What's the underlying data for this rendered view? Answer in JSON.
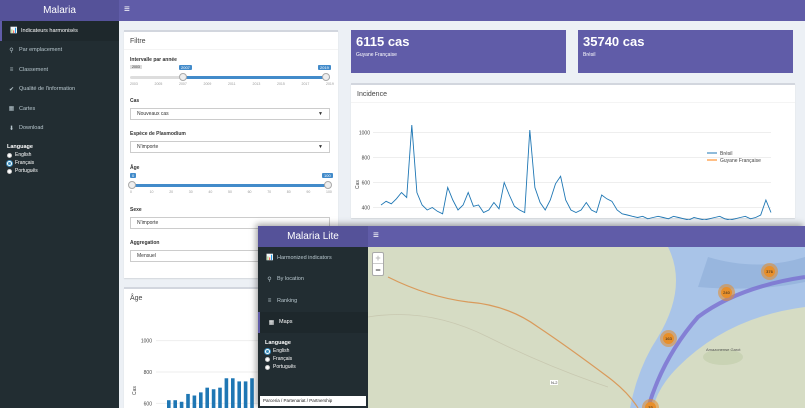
{
  "back": {
    "app_title": "Malaria",
    "hamburger": "≡",
    "nav": [
      {
        "icon": "📊",
        "label": "Indicateurs harmonisés"
      },
      {
        "icon": "⚲",
        "label": "Par emplacement"
      },
      {
        "icon": "≡",
        "label": "Classement"
      },
      {
        "icon": "✔",
        "label": "Qualité de l'information"
      },
      {
        "icon": "▦",
        "label": "Cartes"
      },
      {
        "icon": "⬇",
        "label": "Download"
      }
    ],
    "language_title": "Language",
    "languages": [
      "English",
      "Français",
      "Português"
    ],
    "filter": {
      "title": "Filtre",
      "year_label": "Intervalle par année",
      "year_min": "2003",
      "year_max": "2019",
      "year_from": "2007",
      "year_to": "2019",
      "year_ticks": [
        "2003",
        "2005",
        "2007",
        "2009",
        "2011",
        "2013",
        "2015",
        "2017",
        "2019"
      ],
      "cases_label": "Cas",
      "cases_value": "Nouveaux cas",
      "species_label": "Espèce de Plasmodium",
      "species_value": "N'importe",
      "age_label": "Âge",
      "age_from": "0",
      "age_to": "100",
      "age_ticks": [
        "0",
        "10",
        "20",
        "30",
        "40",
        "50",
        "60",
        "70",
        "80",
        "90",
        "100"
      ],
      "sex_label": "Sexe",
      "sex_value": "N'importe",
      "agg_label": "Aggregation",
      "agg_value": "Mensuel"
    },
    "value_boxes": [
      {
        "value": "6115 cas",
        "label": "Guyane Française"
      },
      {
        "value": "35740 cas",
        "label": "Brésil"
      }
    ],
    "incidence": {
      "title": "Incidence",
      "y_ticks": [
        "1000",
        "800",
        "600",
        "400"
      ],
      "ylabel": "Cas",
      "legend": [
        "Brésil",
        "Guyane Française"
      ]
    },
    "age_box": {
      "title": "Âge",
      "y_ticks": [
        "1000",
        "800",
        "600"
      ],
      "ylabel": "Cas"
    },
    "colors": {
      "header": "#605ca8",
      "brazil": "#1f77b4",
      "guyane": "#ff7f0e",
      "bars": "#1f77b4"
    }
  },
  "chart_data": [
    {
      "type": "line",
      "title": "Incidence",
      "ylabel": "Cas",
      "ylim": [
        300,
        1100
      ],
      "series": [
        {
          "name": "Brésil",
          "values": [
            420,
            450,
            430,
            470,
            520,
            480,
            1060,
            520,
            420,
            380,
            400,
            370,
            350,
            560,
            460,
            380,
            420,
            520,
            410,
            420,
            360,
            380,
            440,
            390,
            600,
            500,
            410,
            380,
            360,
            1020,
            560,
            440,
            380,
            460,
            590,
            650,
            460,
            380,
            360,
            380,
            440,
            380,
            360,
            500,
            470,
            450,
            380,
            350,
            340,
            330,
            320,
            330,
            310,
            320,
            330,
            320,
            310,
            330,
            320,
            310,
            300,
            320,
            310,
            300,
            310,
            320,
            330,
            310,
            300,
            310,
            320,
            330,
            310,
            320,
            340,
            460,
            360
          ]
        },
        {
          "name": "Guyane Française",
          "values": []
        }
      ]
    },
    {
      "type": "bar",
      "title": "Âge",
      "ylabel": "Cas",
      "ylim": [
        500,
        1100
      ],
      "values": [
        620,
        620,
        610,
        660,
        650,
        670,
        700,
        690,
        700,
        760,
        760,
        740,
        740,
        760
      ]
    }
  ],
  "front": {
    "app_title": "Malaria Lite",
    "hamburger": "≡",
    "nav": [
      {
        "icon": "📊",
        "label": "Harmonized indicators"
      },
      {
        "icon": "⚲",
        "label": "By location"
      },
      {
        "icon": "≡",
        "label": "Ranking"
      },
      {
        "icon": "▦",
        "label": "Maps"
      }
    ],
    "language_title": "Language",
    "languages": [
      "English",
      "Français",
      "Português"
    ],
    "partnership": "Parceria / Partenariat / Partnership",
    "map": {
      "zoom_in": "+",
      "zoom_out": "−",
      "road_label": "N-2",
      "place_label": "Amazonense Garot",
      "clusters": [
        "376",
        "240",
        "163",
        "33"
      ]
    }
  }
}
